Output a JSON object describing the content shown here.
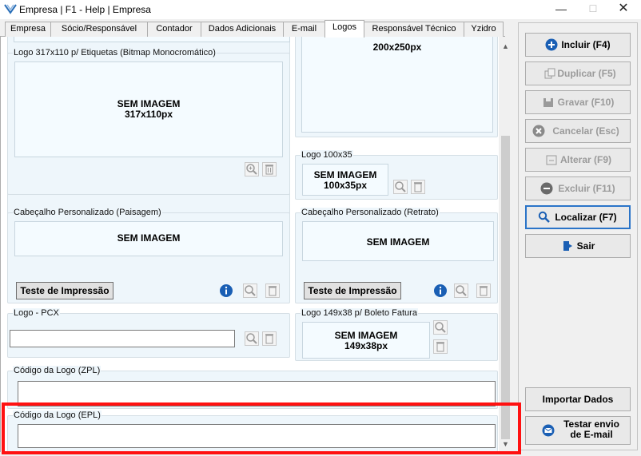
{
  "window": {
    "title": "Empresa | F1 - Help | Empresa",
    "minimize": "—",
    "maximize": "☐",
    "close": "✕"
  },
  "tabs": [
    "Empresa",
    "Sócio/Responsável",
    "Contador",
    "Dados Adicionais",
    "E-mail",
    "Logos",
    "Responsável Técnico",
    "Yzidro"
  ],
  "active_tab": "Logos",
  "logos": {
    "etiquetas": {
      "legend": "Logo 317x110 p/ Etiquetas (Bitmap Monocromático)",
      "line1": "SEM IMAGEM",
      "line2": "317x110px"
    },
    "logo200": {
      "line2": "200x250px"
    },
    "logo100": {
      "legend": "Logo 100x35",
      "line1": "SEM IMAGEM",
      "line2": "100x35px"
    },
    "paisagem": {
      "legend": "Cabeçalho Personalizado (Paisagem)",
      "line1": "SEM IMAGEM",
      "test_button": "Teste de Impressão"
    },
    "retrato": {
      "legend": "Cabeçalho Personalizado (Retrato)",
      "line1": "SEM IMAGEM",
      "test_button": "Teste de Impressão"
    },
    "pcx": {
      "legend": "Logo - PCX",
      "value": ""
    },
    "boleto": {
      "legend": "Logo 149x38 p/ Boleto Fatura",
      "line1": "SEM IMAGEM",
      "line2": "149x38px"
    },
    "zpl": {
      "legend": "Código da Logo (ZPL)",
      "value": ""
    },
    "epl": {
      "legend": "Código da Logo (EPL)",
      "value": ""
    }
  },
  "sidebar": {
    "incluir": "Incluir (F4)",
    "duplicar": "Duplicar (F5)",
    "gravar": "Gravar (F10)",
    "cancelar": "Cancelar (Esc)",
    "alterar": "Alterar (F9)",
    "excluir": "Excluir (F11)",
    "localizar": "Localizar (F7)",
    "sair": "Sair",
    "importar": "Importar Dados",
    "testar_line1": "Testar envio",
    "testar_line2": "de E-mail"
  },
  "colors": {
    "accent": "#2a74c8",
    "highlight": "#ff1111",
    "panel": "#eef6fb"
  }
}
